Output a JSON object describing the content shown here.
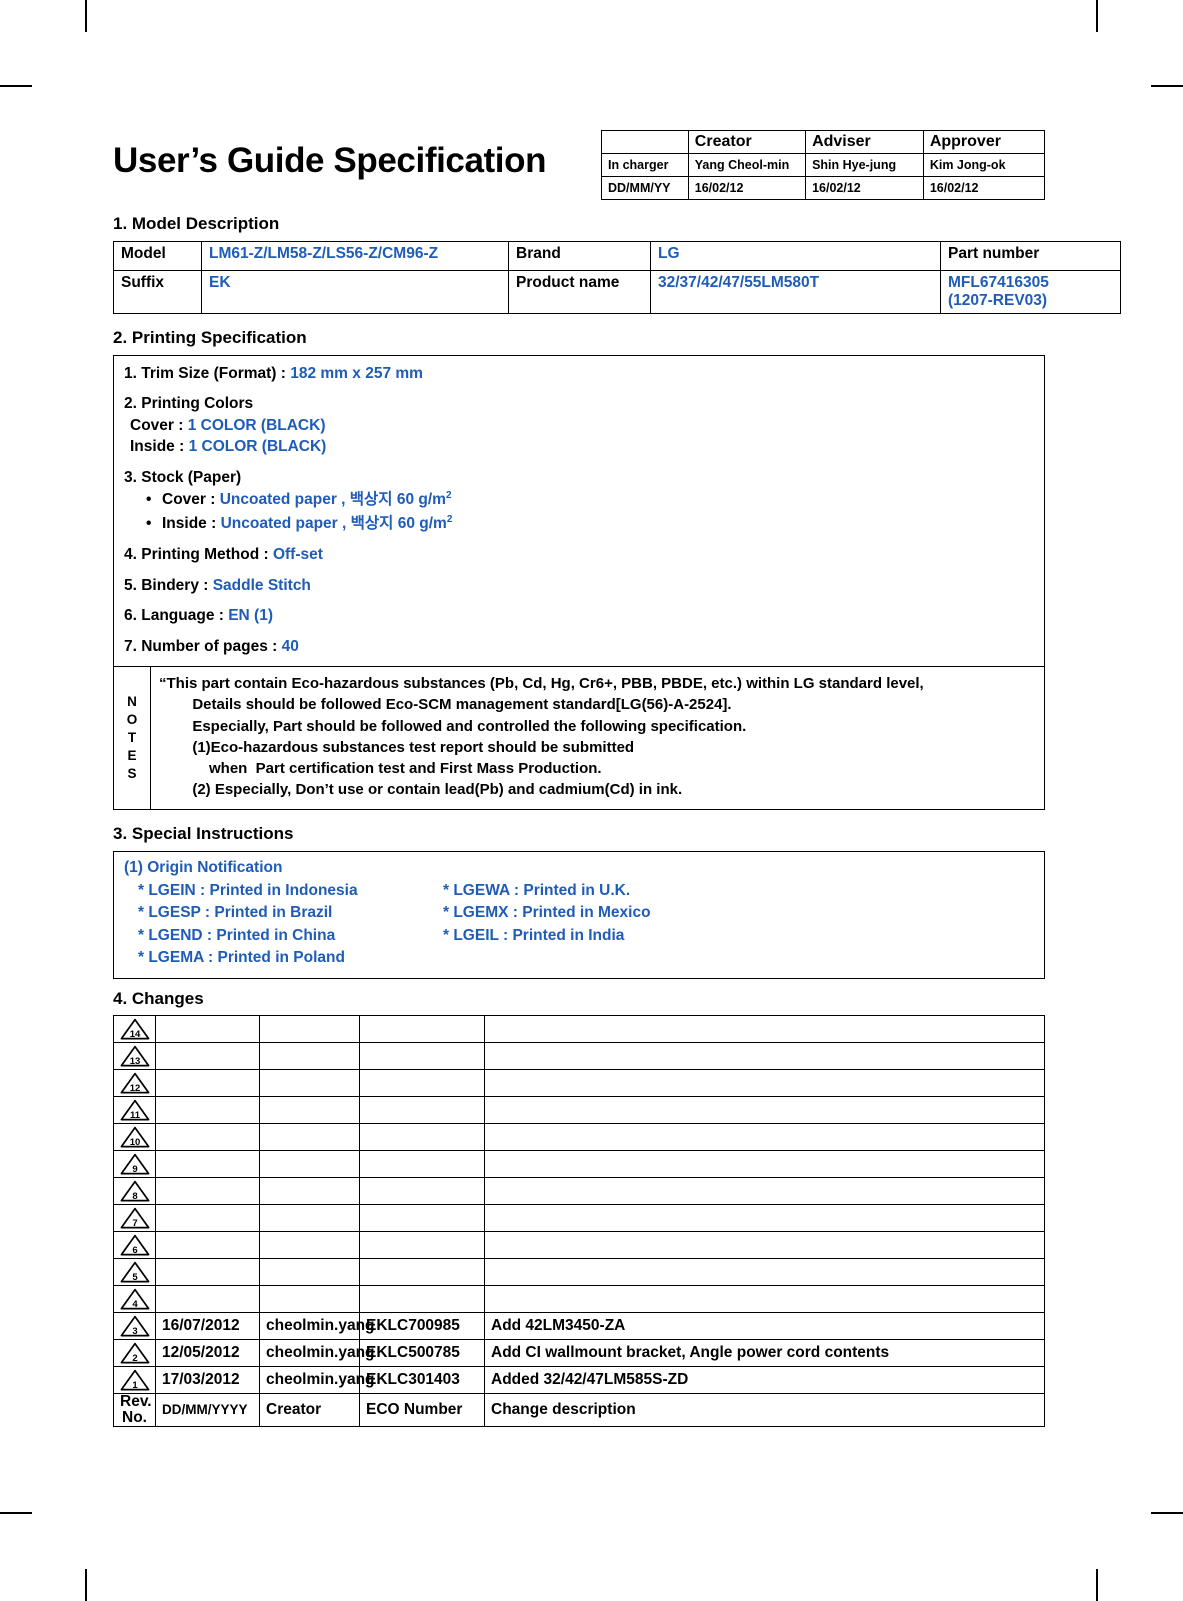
{
  "document": {
    "title": "User’s Guide Specification"
  },
  "signoff": {
    "columns": [
      "",
      "Creator",
      "Adviser",
      "Approver"
    ],
    "rows": [
      {
        "label": "In charger",
        "values": [
          "Yang Cheol-min",
          "Shin Hye-jung",
          "Kim Jong-ok"
        ]
      },
      {
        "label": "DD/MM/YY",
        "values": [
          "16/02/12",
          "16/02/12",
          "16/02/12"
        ]
      }
    ]
  },
  "sections": {
    "model_description": {
      "heading": "1. Model Description",
      "row1": {
        "label1": "Model",
        "value1": "LM61-Z/LM58-Z/LS56-Z/CM96-Z",
        "label2": "Brand",
        "value2": "LG",
        "label3": "Part number"
      },
      "row2": {
        "label1": "Suffix",
        "value1": "EK",
        "label2": "Product name",
        "value2": "32/37/42/47/55LM580T",
        "value3_line1": "MFL67416305",
        "value3_line2": "(1207-REV03)"
      }
    },
    "printing_specification": {
      "heading": "2. Printing Specification",
      "item1_label": "1. Trim Size (Format) : ",
      "item1_value": "182 mm x 257 mm",
      "item2_label": "2. Printing Colors",
      "item2_cover_label": "Cover : ",
      "item2_cover_value": "1 COLOR (BLACK)",
      "item2_inside_label": "Inside : ",
      "item2_inside_value": "1 COLOR (BLACK)",
      "item3_label": "3. Stock (Paper)",
      "item3_cover_label": "Cover : ",
      "item3_cover_value": "Uncoated paper , 백상지 60 g/m",
      "item3_cover_sup": "2",
      "item3_inside_label": "Inside : ",
      "item3_inside_value": "Uncoated paper , 백상지 60 g/m",
      "item3_inside_sup": "2",
      "item4_label": "4. Printing Method : ",
      "item4_value": "Off-set",
      "item5_label": "5. Bindery  : ",
      "item5_value": "Saddle Stitch",
      "item6_label": "6. Language : ",
      "item6_value": "EN (1)",
      "item7_label": "7. Number of pages : ",
      "item7_value": "40",
      "notes_label_letters": [
        "N",
        "O",
        "T",
        "E",
        "S"
      ],
      "notes_lines": [
        "“This part contain Eco-hazardous substances (Pb, Cd, Hg, Cr6+, PBB, PBDE, etc.) within LG standard level,",
        "        Details should be followed Eco-SCM management standard[LG(56)-A-2524].",
        "        Especially, Part should be followed and controlled the following specification.",
        "        (1)Eco-hazardous substances test report should be submitted",
        "            when  Part certification test and First Mass Production.",
        "        (2) Especially, Don’t use or contain lead(Pb) and cadmium(Cd) in ink."
      ]
    },
    "special_instructions": {
      "heading": "3. Special Instructions",
      "origin_title": "(1) Origin Notification",
      "origin_rows": [
        {
          "left": "* LGEIN : Printed in Indonesia",
          "right": "* LGEWA : Printed in U.K."
        },
        {
          "left": "* LGESP : Printed in Brazil",
          "right": "* LGEMX : Printed in Mexico"
        },
        {
          "left": "* LGEND : Printed in China",
          "right": "  * LGEIL : Printed in India"
        },
        {
          "left": "* LGEMA : Printed in Poland",
          "right": ""
        }
      ]
    },
    "changes": {
      "heading": "4. Changes",
      "rows": [
        {
          "rev": "14",
          "date": "",
          "creator": "",
          "eco": "",
          "description": ""
        },
        {
          "rev": "13",
          "date": "",
          "creator": "",
          "eco": "",
          "description": ""
        },
        {
          "rev": "12",
          "date": "",
          "creator": "",
          "eco": "",
          "description": ""
        },
        {
          "rev": "11",
          "date": "",
          "creator": "",
          "eco": "",
          "description": ""
        },
        {
          "rev": "10",
          "date": "",
          "creator": "",
          "eco": "",
          "description": ""
        },
        {
          "rev": "9",
          "date": "",
          "creator": "",
          "eco": "",
          "description": ""
        },
        {
          "rev": "8",
          "date": "",
          "creator": "",
          "eco": "",
          "description": ""
        },
        {
          "rev": "7",
          "date": "",
          "creator": "",
          "eco": "",
          "description": ""
        },
        {
          "rev": "6",
          "date": "",
          "creator": "",
          "eco": "",
          "description": ""
        },
        {
          "rev": "5",
          "date": "",
          "creator": "",
          "eco": "",
          "description": ""
        },
        {
          "rev": "4",
          "date": "",
          "creator": "",
          "eco": "",
          "description": ""
        },
        {
          "rev": "3",
          "date": "16/07/2012",
          "creator": "cheolmin.yang",
          "eco": "EKLC700985",
          "description": "Add 42LM3450-ZA"
        },
        {
          "rev": "2",
          "date": "12/05/2012",
          "creator": "cheolmin.yang",
          "eco": "EKLC500785",
          "description": "Add CI wallmount bracket, Angle power cord contents"
        },
        {
          "rev": "1",
          "date": "17/03/2012",
          "creator": "cheolmin.yang",
          "eco": "EKLC301403",
          "description": "Added 32/42/47LM585S-ZD"
        }
      ],
      "footer": {
        "rev_line1": "Rev.",
        "rev_line2": "No.",
        "date": "DD/MM/YYYY",
        "creator": "Creator",
        "eco": "ECO Number",
        "description": "Change description"
      }
    }
  },
  "colors": {
    "accent_blue": "#1F5CB8",
    "text_black": "#000000",
    "page_background": "#FFFFFF"
  }
}
